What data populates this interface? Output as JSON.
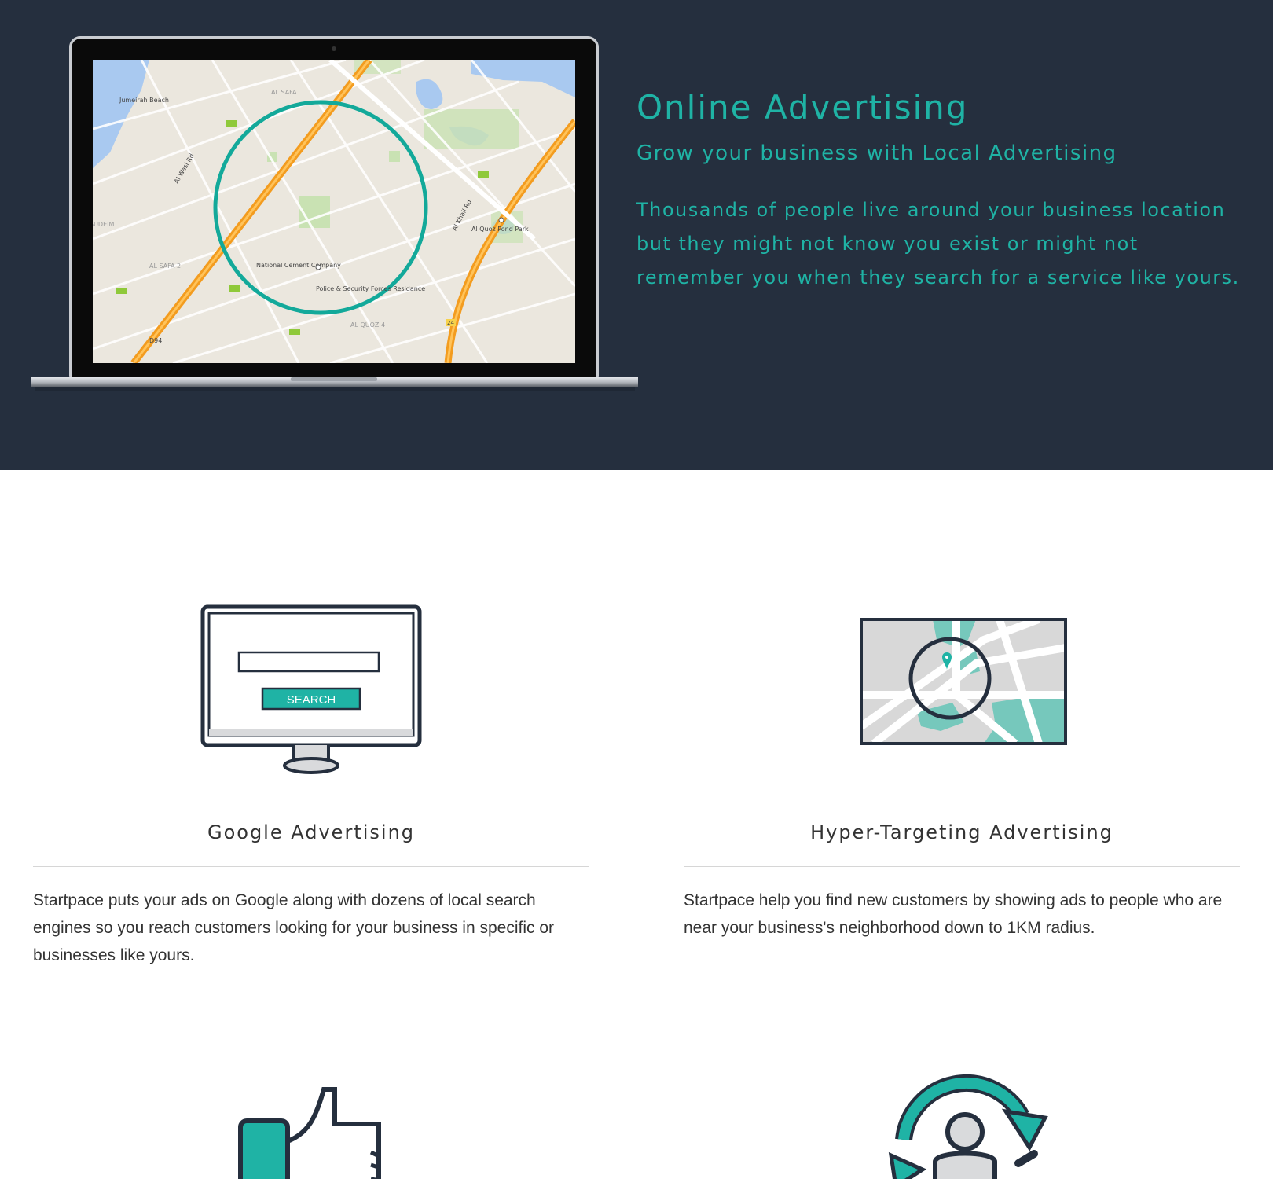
{
  "hero": {
    "title": "Online Advertising",
    "subtitle": "Grow your business with Local Advertising",
    "text_lines": [
      "Thousands of people live around your business location",
      "but they might not know you exist or might not",
      "remember you when they search for a service like yours."
    ],
    "map_labels": {
      "jumeirah": "Jumeirah Beach",
      "al_safa": "AL SAFA",
      "al_safa_2": "AL SAFA 2",
      "al_quoz_4": "AL QUOZ 4",
      "sudeim": "SUDEIM",
      "pond_park": "Al Quoz Pond Park",
      "cement": "National Cement Company",
      "police": "Police & Security Forces Residance",
      "khail_rd": "Al Khail Rd",
      "wasl_rd": "Al Wasl Rd",
      "shield_e": "D94",
      "route_24": "24"
    },
    "colors": {
      "background": "#252f3e",
      "accent": "#1fb3a5"
    }
  },
  "features": [
    {
      "icon": "monitor-search-icon",
      "title": "Google Advertising",
      "icon_button_label": "SEARCH",
      "description": [
        "Startpace puts your ads on Google along with dozens of local search",
        "engines so you reach customers looking for your business in specific or",
        "businesses like yours."
      ]
    },
    {
      "icon": "map-target-icon",
      "title": "Hyper-Targeting Advertising",
      "description": [
        "Startpace help you find new customers by showing ads to people who are",
        "near your business's neighborhood down to 1KM radius."
      ]
    },
    {
      "icon": "thumbs-up-icon"
    },
    {
      "icon": "retargeting-person-icon"
    }
  ]
}
